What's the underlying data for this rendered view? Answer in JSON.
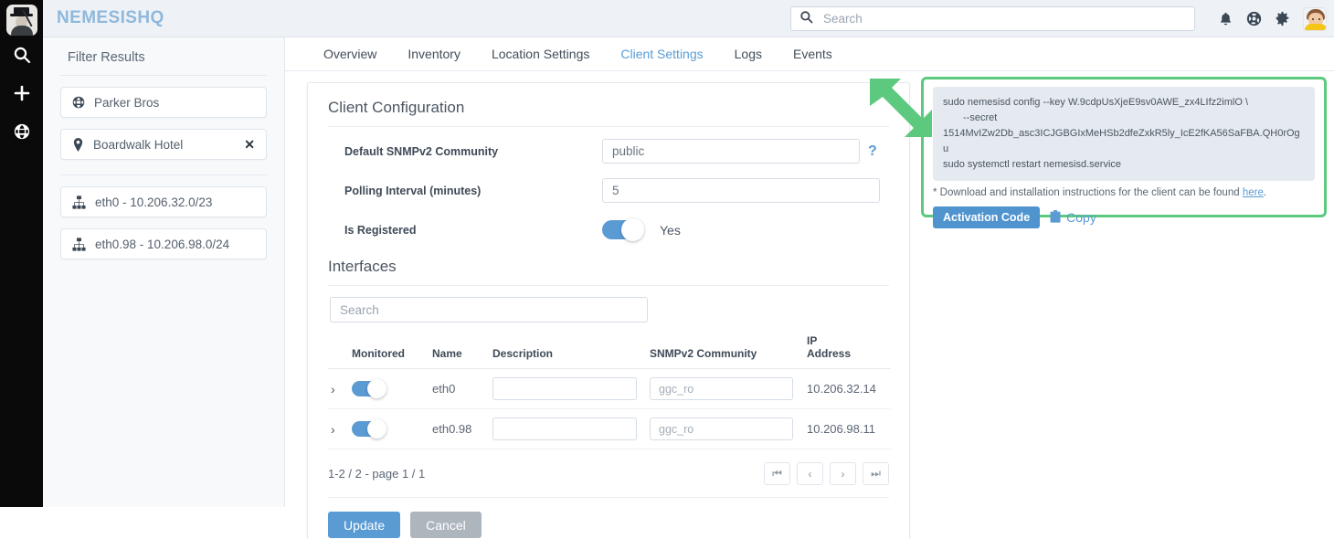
{
  "brand": {
    "name": "NEMESISHQ",
    "color": "#8fb8db",
    "logo_icon": "monopoly-man-logo"
  },
  "rail": {
    "items": [
      {
        "icon": "search-icon",
        "name": "search"
      },
      {
        "icon": "plus-icon",
        "name": "add"
      },
      {
        "icon": "globe-icon",
        "name": "globe"
      }
    ]
  },
  "topbar": {
    "search": {
      "value": "",
      "placeholder": "Search",
      "icon": "search-icon"
    },
    "icons": [
      {
        "icon": "bell-icon",
        "name": "notifications"
      },
      {
        "icon": "lifering-icon",
        "name": "help"
      },
      {
        "icon": "gear-icon",
        "name": "settings"
      },
      {
        "icon": "avatar",
        "name": "user-profile"
      }
    ]
  },
  "sidebar": {
    "title": "Filter Results",
    "filters": [
      {
        "icon": "globe-icon",
        "label": "Parker Bros",
        "removable": false
      },
      {
        "icon": "location-pin-icon",
        "label": "Boardwalk Hotel",
        "removable": true,
        "remove_glyph": "✕"
      }
    ],
    "interfaces": [
      {
        "icon": "network-icon",
        "label": "eth0 - 10.206.32.0/23"
      },
      {
        "icon": "network-icon",
        "label": "eth0.98 - 10.206.98.0/24"
      }
    ]
  },
  "tabs": [
    {
      "label": "Overview",
      "active": false
    },
    {
      "label": "Inventory",
      "active": false
    },
    {
      "label": "Location Settings",
      "active": false
    },
    {
      "label": "Client Settings",
      "active": true
    },
    {
      "label": "Logs",
      "active": false
    },
    {
      "label": "Events",
      "active": false
    }
  ],
  "client_config": {
    "title": "Client Configuration",
    "fields": [
      {
        "label": "Default SNMPv2 Community",
        "value": "public",
        "help": "?"
      },
      {
        "label": "Polling Interval (minutes)",
        "value": "5"
      }
    ],
    "registered": {
      "label": "Is Registered",
      "state": "on",
      "state_text": "Yes"
    }
  },
  "interfaces_section": {
    "title": "Interfaces",
    "search_placeholder": "Search",
    "search_value": "",
    "columns": [
      "Monitored",
      "Name",
      "Description",
      "SNMPv2 Community",
      "IP Address"
    ],
    "ip_header_line1": "IP",
    "ip_header_line2": "Address",
    "rows": [
      {
        "expand_glyph": "›",
        "monitored": "on",
        "name": "eth0",
        "description_value": "",
        "description_placeholder": "",
        "community_value": "",
        "community_placeholder": "ggc_ro",
        "ip": "10.206.32.14"
      },
      {
        "expand_glyph": "›",
        "monitored": "on",
        "name": "eth0.98",
        "description_value": "",
        "description_placeholder": "",
        "community_value": "",
        "community_placeholder": "ggc_ro",
        "ip": "10.206.98.11"
      }
    ],
    "pagination": {
      "summary": "1-2 / 2 - page 1 / 1",
      "first": "⏮",
      "prev": "‹",
      "next": "›",
      "last": "⏭"
    }
  },
  "form_actions": {
    "update": "Update",
    "cancel": "Cancel",
    "update_color": "#5a9bd4",
    "cancel_color": "#adb5bd"
  },
  "activation": {
    "highlight_color": "#5cc97f",
    "code_line_1": "sudo nemesisd config --key W.9cdpUsXjeE9sv0AWE_zx4LIfz2imlO \\",
    "code_line_2": "--secret",
    "code_line_3": "1514MvIZw2Db_asc3ICJGBGIxMeHSb2dfeZxkR5ly_IcE2fKA56SaFBA.QH0rOgu",
    "code_line_4": "sudo systemctl restart nemesisd.service",
    "note_prefix": "* Download and installation instructions for the client can be found ",
    "note_link": "here",
    "note_suffix": ".",
    "activation_button": "Activation Code",
    "copy_label": "Copy",
    "copy_icon": "clipboard-icon"
  },
  "annotation": {
    "arrow_color": "#5cc97f",
    "arrow_direction": "down-right"
  }
}
